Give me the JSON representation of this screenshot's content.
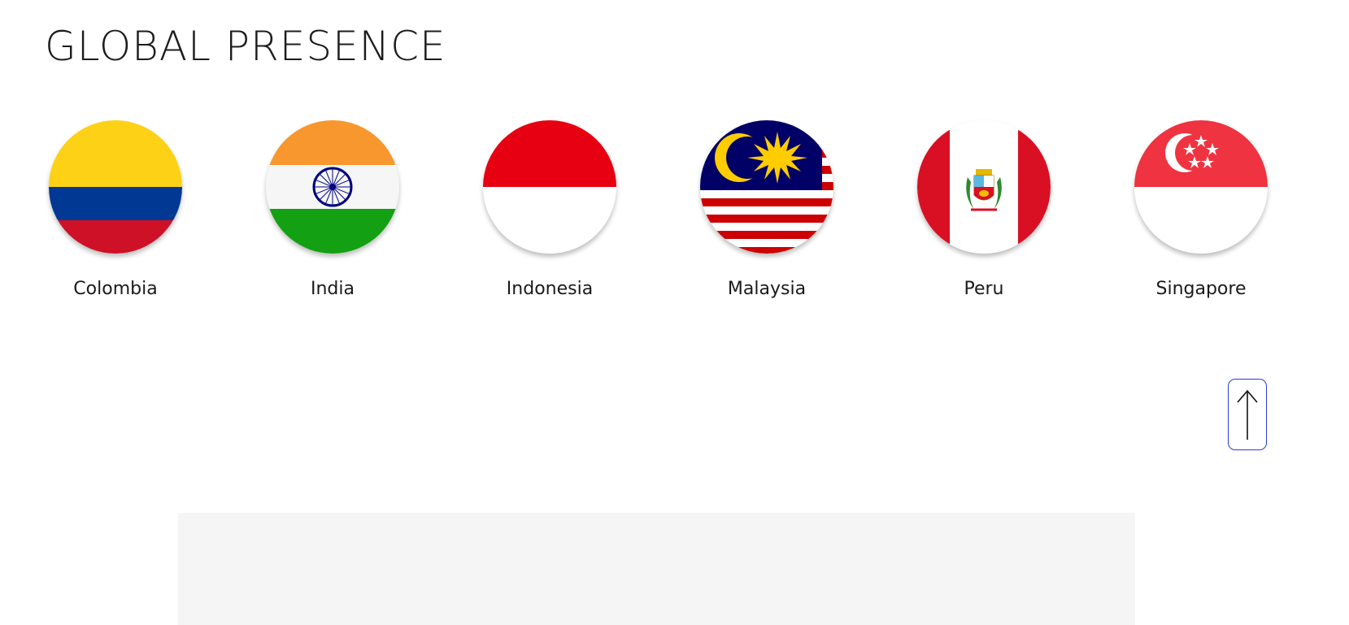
{
  "section": {
    "title": "GLOBAL PRESENCE"
  },
  "countries": [
    {
      "name": "Colombia",
      "flag_icon": "colombia-flag-icon"
    },
    {
      "name": "India",
      "flag_icon": "india-flag-icon"
    },
    {
      "name": "Indonesia",
      "flag_icon": "indonesia-flag-icon"
    },
    {
      "name": "Malaysia",
      "flag_icon": "malaysia-flag-icon"
    },
    {
      "name": "Peru",
      "flag_icon": "peru-flag-icon"
    },
    {
      "name": "Singapore",
      "flag_icon": "singapore-flag-icon"
    }
  ],
  "scroll_top": {
    "icon": "arrow-up-icon",
    "border_color": "#2b3bd6"
  },
  "colors": {
    "colombia_yellow": "#fdd116",
    "colombia_blue": "#003893",
    "colombia_red": "#ce1126",
    "india_saffron": "#f7972d",
    "india_green": "#138808",
    "india_chakra": "#000080",
    "indonesia_red": "#e70011",
    "malaysia_blue": "#010066",
    "malaysia_red": "#cc0001",
    "malaysia_yellow": "#ffcc00",
    "peru_red": "#d91023",
    "singapore_red": "#ef3340",
    "panel_gray": "#f5f5f5"
  }
}
